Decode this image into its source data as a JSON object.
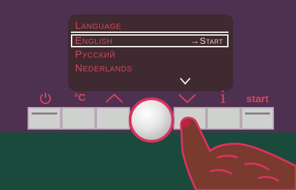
{
  "menu": {
    "items": [
      "Language",
      "English",
      "Русский",
      "Nederlands"
    ],
    "selected_hint": "→start"
  },
  "icons": {
    "power": "power-icon",
    "temp_label": "°C",
    "up": "chevron-up-icon",
    "down": "chevron-down-icon",
    "info_label": "i",
    "start_label": "start"
  },
  "colors": {
    "accent": "#d9465c",
    "panel": "#4e3150",
    "display": "#3e2a30",
    "lower_panel": "#1a4a3c",
    "knob_ring": "#d9325e"
  }
}
